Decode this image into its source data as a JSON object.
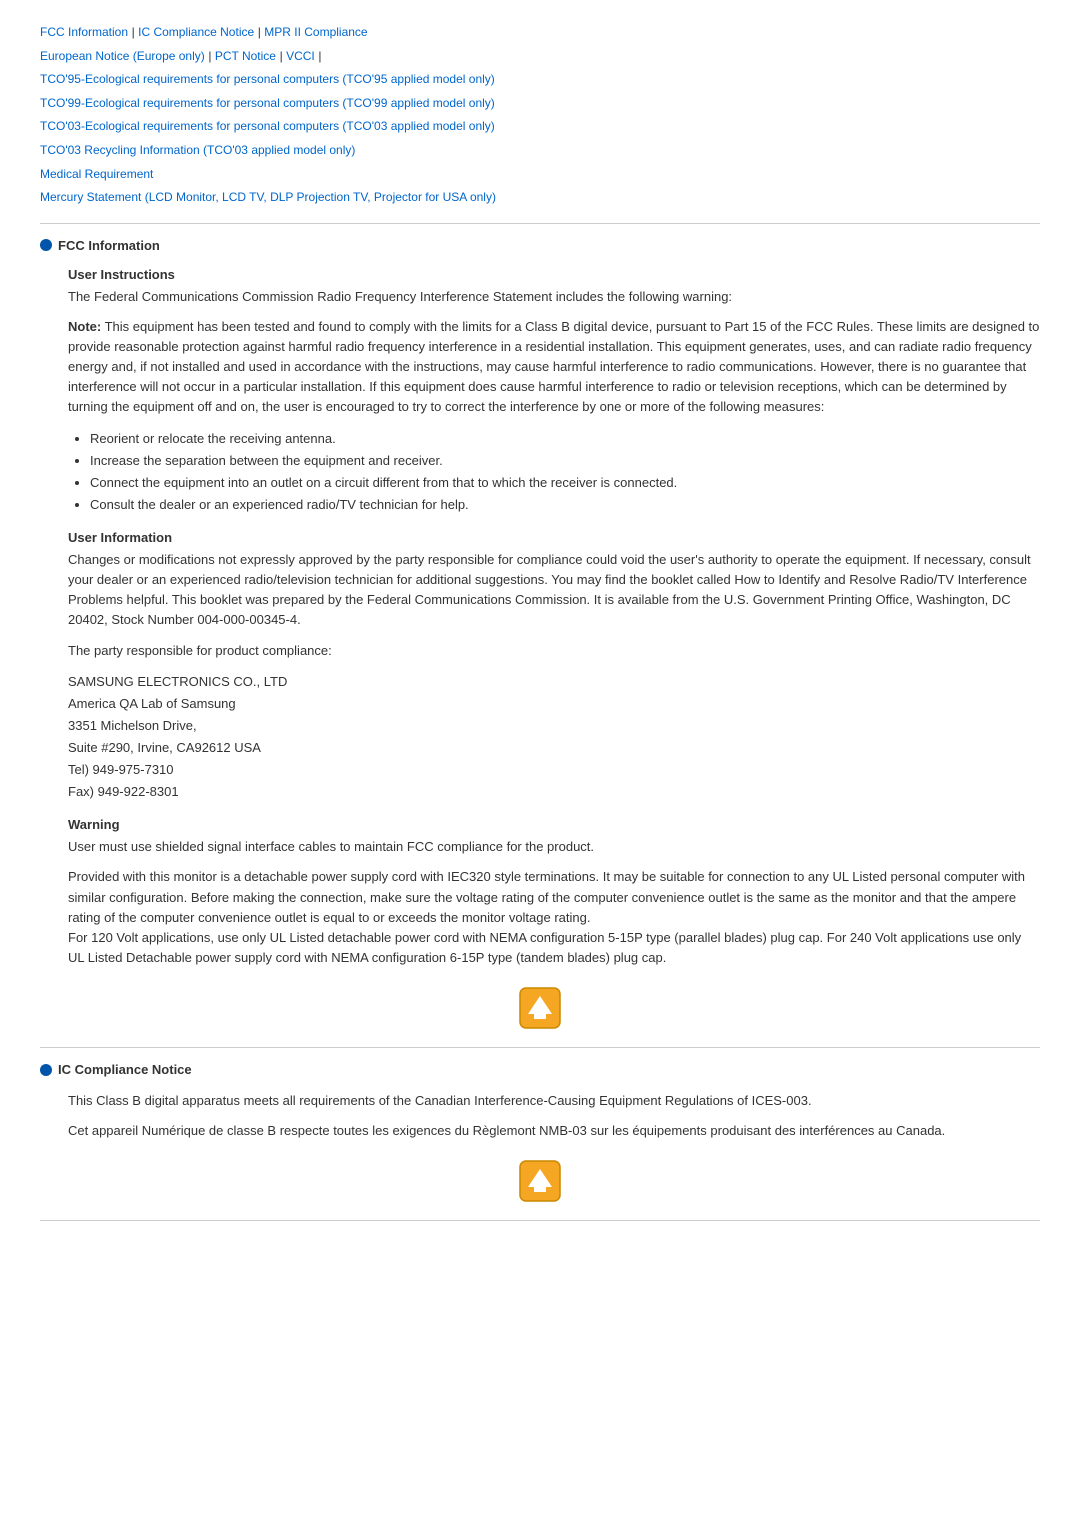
{
  "nav": {
    "links": [
      {
        "label": "FCC Information",
        "id": "fcc-link"
      },
      {
        "label": "IC Compliance Notice",
        "id": "ic-link"
      },
      {
        "label": "MPR II Compliance",
        "id": "mpr-link"
      },
      {
        "label": "European Notice (Europe only)",
        "id": "eu-link"
      },
      {
        "label": "PCT Notice",
        "id": "pct-link"
      },
      {
        "label": "VCCI",
        "id": "vcci-link"
      },
      {
        "label": "TCO'95-Ecological requirements for personal computers (TCO'95 applied model only)",
        "id": "tco95-link"
      },
      {
        "label": "TCO'99-Ecological requirements for personal computers (TCO'99 applied model only)",
        "id": "tco99-link"
      },
      {
        "label": "TCO'03-Ecological requirements for personal computers (TCO'03 applied model only)",
        "id": "tco03-link"
      },
      {
        "label": "TCO'03 Recycling Information (TCO'03 applied model only)",
        "id": "tco03r-link"
      },
      {
        "label": "Medical Requirement",
        "id": "medical-link"
      },
      {
        "label": "Mercury Statement (LCD Monitor, LCD TV, DLP Projection TV, Projector for USA only)",
        "id": "mercury-link"
      }
    ]
  },
  "fcc_section": {
    "title": "FCC Information",
    "user_instructions": {
      "subtitle": "User Instructions",
      "para1": "The Federal Communications Commission Radio Frequency Interference Statement includes the following warning:",
      "para2_bold": "Note:",
      "para2_rest": " This equipment has been tested and found to comply with the limits for a Class B digital device, pursuant to Part 15 of the FCC Rules. These limits are designed to provide reasonable protection against harmful radio frequency interference in a residential installation. This equipment generates, uses, and can radiate radio frequency energy and, if not installed and used in accordance with the instructions, may cause harmful interference to radio communications. However, there is no guarantee that interference will not occur in a particular installation. If this equipment does cause harmful interference to radio or television receptions, which can be determined by turning the equipment off and on, the user is encouraged to try to correct the interference by one or more of the following measures:",
      "bullets": [
        "Reorient or relocate the receiving antenna.",
        "Increase the separation between the equipment and receiver.",
        "Connect the equipment into an outlet on a circuit different from that to which the receiver is connected.",
        "Consult the dealer or an experienced radio/TV technician for help."
      ]
    },
    "user_information": {
      "subtitle": "User Information",
      "para1": "Changes or modifications not expressly approved by the party responsible for compliance could void the user's authority to operate the equipment. If necessary, consult your dealer or an experienced radio/television technician for additional suggestions. You may find the booklet called How to Identify and Resolve Radio/TV Interference Problems helpful. This booklet was prepared by the Federal Communications Commission. It is available from the U.S. Government Printing Office, Washington, DC 20402, Stock Number 004-000-00345-4.",
      "para2": "The party responsible for product compliance:",
      "address": "SAMSUNG ELECTRONICS CO., LTD\nAmerica QA Lab of Samsung\n3351 Michelson Drive,\nSuite #290, Irvine, CA92612 USA\nTel) 949-975-7310\nFax) 949-922-8301"
    },
    "warning": {
      "subtitle": "Warning",
      "para1": "User must use shielded signal interface cables to maintain FCC compliance for the product.",
      "para2": "Provided with this monitor is a detachable power supply cord with IEC320 style terminations. It may be suitable for connection to any UL Listed personal computer with similar configuration. Before making the connection, make sure the voltage rating of the computer convenience outlet is the same as the monitor and that the ampere rating of the computer convenience outlet is equal to or exceeds the monitor voltage rating.\nFor 120 Volt applications, use only UL Listed detachable power cord with NEMA configuration 5-15P type (parallel blades) plug cap. For 240 Volt applications use only UL Listed Detachable power supply cord with NEMA configuration 6-15P type (tandem blades) plug cap."
    }
  },
  "ic_section": {
    "title": "IC Compliance Notice",
    "para1": "This Class B digital apparatus meets all requirements of the Canadian Interference-Causing Equipment Regulations of ICES-003.",
    "para2": "Cet appareil Numérique de classe B respecte toutes les exigences du Règlemont NMB-03 sur les équipements produisant des interférences au Canada."
  },
  "top_button_label": "Top"
}
